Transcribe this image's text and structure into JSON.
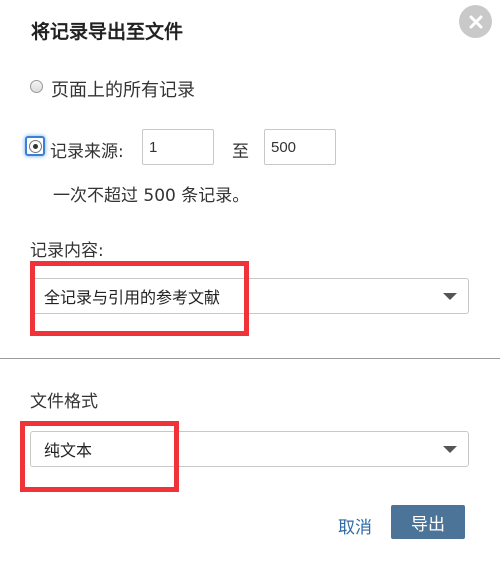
{
  "dialog": {
    "title": "将记录导出至文件",
    "close_icon": "close-icon"
  },
  "record_range": {
    "option_all_label": "页面上的所有记录",
    "option_source_label": "记录来源:",
    "from_value": "1",
    "to_label": "至",
    "to_value": "500",
    "hint": "一次不超过 500 条记录。",
    "selected_option": "source"
  },
  "record_content": {
    "label": "记录内容:",
    "selected_value": "全记录与引用的参考文献"
  },
  "file_format": {
    "label": "文件格式",
    "selected_value": "纯文本"
  },
  "actions": {
    "cancel_label": "取消",
    "export_label": "导出"
  },
  "colors": {
    "highlight": "#ef3339",
    "primary_button": "#4c7398",
    "link": "#2f6aa8"
  }
}
